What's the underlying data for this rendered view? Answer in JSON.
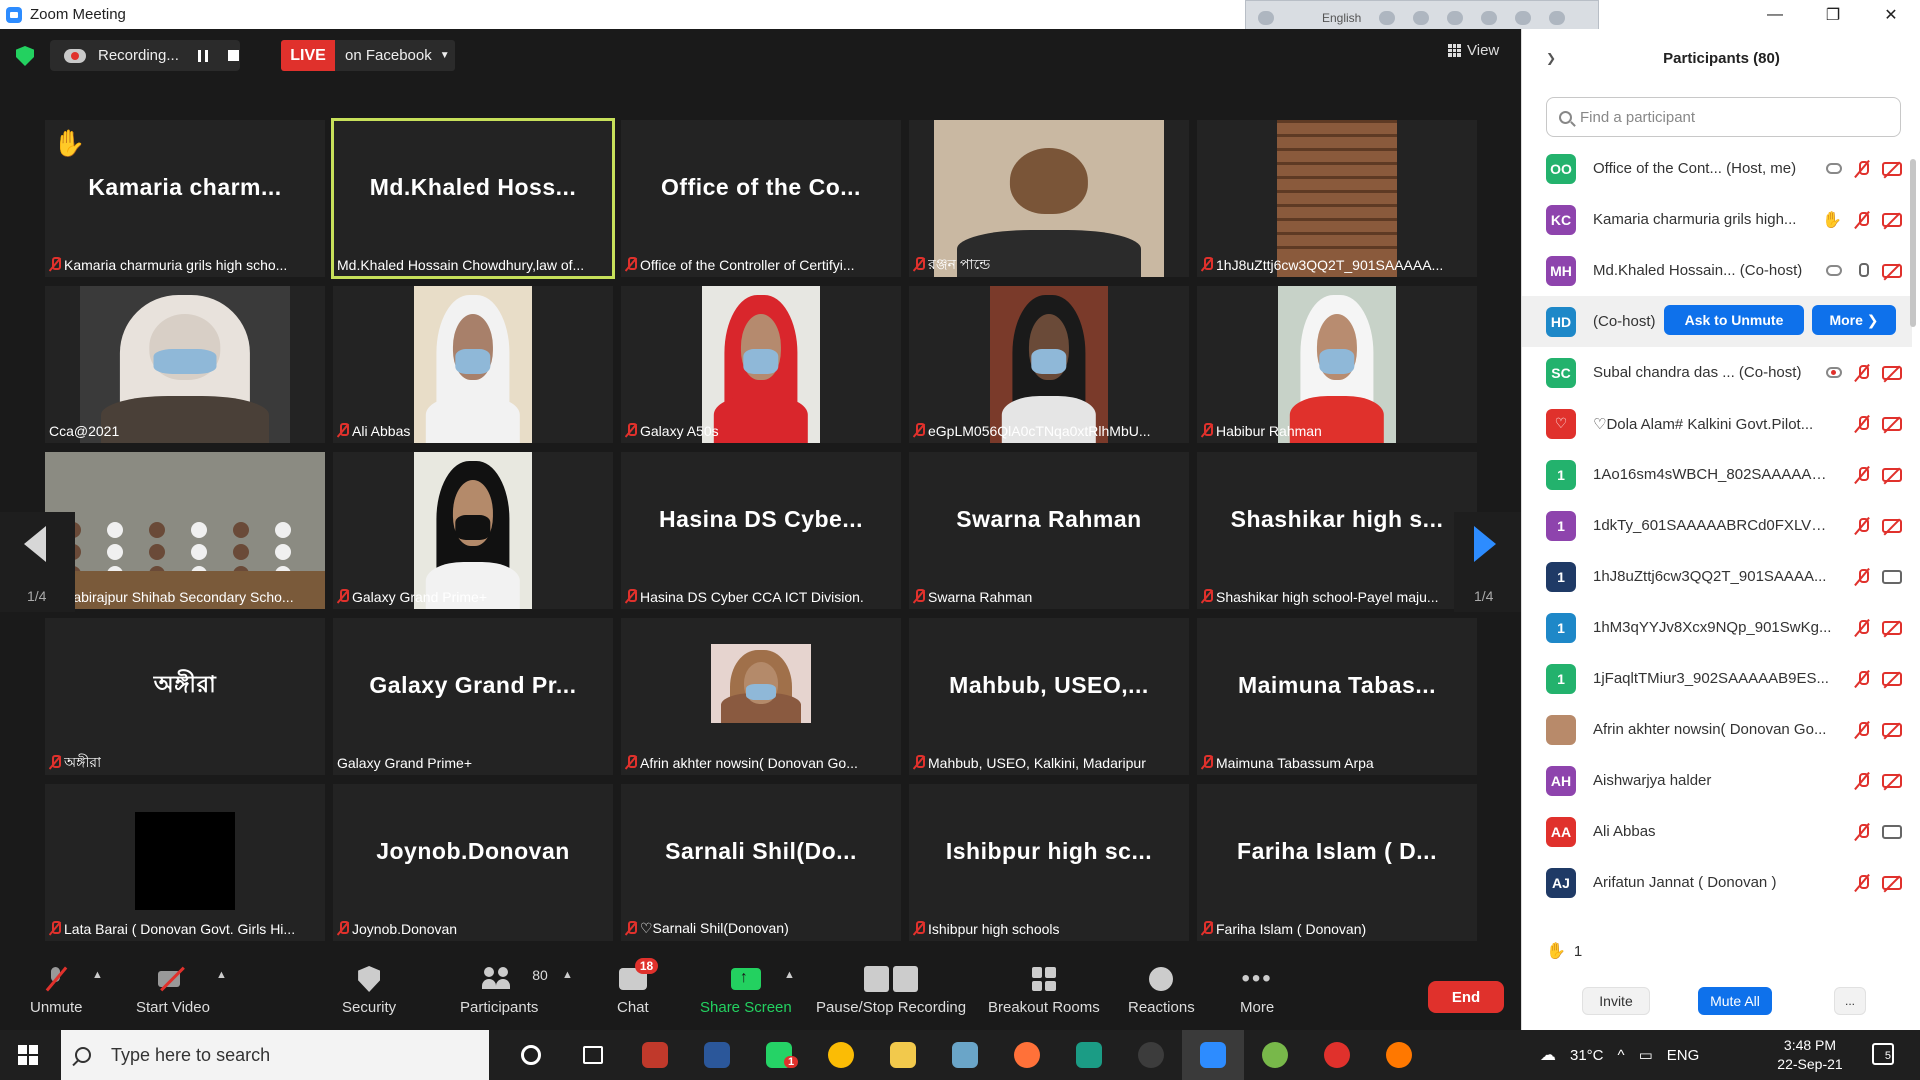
{
  "window": {
    "title": "Zoom Meeting",
    "language_bar_label": "English",
    "minimize": "—",
    "restore": "❐",
    "close": "✕"
  },
  "status": {
    "recording_text": "Recording...",
    "live_badge": "LIVE",
    "live_destination": "on Facebook",
    "view_label": "View"
  },
  "pager": {
    "left": "1/4",
    "right": "1/4"
  },
  "tiles": [
    {
      "big": "Kamaria  charm...",
      "label": "Kamaria charmuria grils high scho...",
      "hand": true
    },
    {
      "big": "Md.Khaled  Hoss...",
      "label": "Md.Khaled Hossain Chowdhury,law of...",
      "active": true,
      "nomic": true
    },
    {
      "big": "Office  of  the  Co...",
      "label": "Office of the Controller of Certifyi..."
    },
    {
      "photo": "man",
      "label": "রঞ্জন পান্ডে"
    },
    {
      "photo": "roof",
      "label": "1hJ8uZttj6cw3QQ2T_901SAAAAA..."
    },
    {
      "photo": "woman-dark",
      "label": "Cca@2021",
      "nomic": true
    },
    {
      "photo": "girl-white",
      "label": "Ali Abbas"
    },
    {
      "photo": "girl-red",
      "label": "Galaxy A50s"
    },
    {
      "photo": "girl-mask",
      "label": "eGpLM056QlA0cTNqa0xtRlhMbU..."
    },
    {
      "photo": "girl-hijab",
      "label": "Habibur Rahman"
    },
    {
      "photo": "classroom",
      "label": "Kabirajpur Shihab Secondary Scho..."
    },
    {
      "photo": "girl-black",
      "label": "Galaxy Grand Prime+"
    },
    {
      "big": "Hasina  DS  Cybe...",
      "label": "Hasina DS Cyber CCA ICT Division."
    },
    {
      "big": "Swarna  Rahman",
      "label": "Swarna Rahman"
    },
    {
      "big": "Shashikar  high  s...",
      "label": "Shashikar high school-Payel maju..."
    },
    {
      "big": "অঙ্গীরা",
      "label": "অঙ্গীরা"
    },
    {
      "big": "Galaxy  Grand  Pr...",
      "label": "Galaxy Grand Prime+",
      "nomic": true
    },
    {
      "photo": "girl-brown",
      "label": "Afrin akhter nowsin( Donovan Go..."
    },
    {
      "big": "Mahbub,  USEO,...",
      "label": "Mahbub, USEO, Kalkini, Madaripur"
    },
    {
      "big": "Maimuna  Tabas...",
      "label": "Maimuna Tabassum Arpa"
    },
    {
      "photo": "black",
      "label": "Lata Barai ( Donovan Govt. Girls Hi..."
    },
    {
      "big": "Joynob.Donovan",
      "label": "Joynob.Donovan"
    },
    {
      "big": "Sarnali  Shil(Do...",
      "label": "♡Sarnali Shil(Donovan)"
    },
    {
      "big": "Ishibpur  high  sc...",
      "label": "Ishibpur high schools"
    },
    {
      "big": "Fariha  Islam  (  D...",
      "label": "Fariha Islam ( Donovan)"
    }
  ],
  "toolbar": {
    "unmute": "Unmute",
    "start_video": "Start Video",
    "security": "Security",
    "participants": "Participants",
    "participants_count": "80",
    "chat": "Chat",
    "chat_badge": "18",
    "share_screen": "Share Screen",
    "pause_stop_recording": "Pause/Stop Recording",
    "breakout_rooms": "Breakout Rooms",
    "reactions": "Reactions",
    "more": "More",
    "end": "End"
  },
  "panel": {
    "title": "Participants (80)",
    "search_placeholder": "Find a participant",
    "ask_to_unmute": "Ask to Unmute",
    "more": "More ❯",
    "participants": [
      {
        "initials": "OO",
        "color": "#23b26d",
        "name": "Office of the Cont...  (Host, me)",
        "icons": [
          "cloud",
          "micoff",
          "camoff"
        ]
      },
      {
        "initials": "KC",
        "color": "#8e44ad",
        "name": "Kamaria charmuria grils high...",
        "icons": [
          "hand",
          "micoff",
          "camoff"
        ]
      },
      {
        "initials": "MH",
        "color": "#8e44ad",
        "name": "Md.Khaled Hossain...  (Co-host)",
        "icons": [
          "cloud",
          "micon",
          "camoff"
        ]
      },
      {
        "initials": "HD",
        "color": "#1e88c8",
        "name": "(Co-host)",
        "hover": true,
        "icons": []
      },
      {
        "initials": "SC",
        "color": "#23b26d",
        "name": "Subal chandra das ...  (Co-host)",
        "icons": [
          "rec",
          "micoff",
          "camoff"
        ]
      },
      {
        "initials": "♡",
        "color": "#e0312c",
        "name": "♡Dola Alam# Kalkini Govt.Pilot...",
        "icons": [
          "micoff",
          "camoff"
        ]
      },
      {
        "initials": "1",
        "color": "#23b26d",
        "name": "1Ao16sm4sWBCH_802SAAAAAB...",
        "icons": [
          "micoff",
          "camoff"
        ]
      },
      {
        "initials": "1",
        "color": "#8e44ad",
        "name": "1dkTy_601SAAAAABRCd0FXLVVt...",
        "icons": [
          "micoff",
          "camoff"
        ]
      },
      {
        "initials": "1",
        "color": "#1f3a66",
        "name": "1hJ8uZttj6cw3QQ2T_901SAAAA...",
        "icons": [
          "micoff",
          "camon"
        ]
      },
      {
        "initials": "1",
        "color": "#1e88c8",
        "name": "1hM3qYYJv8Xcx9NQp_901SwKg...",
        "icons": [
          "micoff",
          "camoff"
        ]
      },
      {
        "initials": "1",
        "color": "#23b26d",
        "name": "1jFaqltTMiur3_902SAAAAAB9ES...",
        "icons": [
          "micoff",
          "camoff"
        ]
      },
      {
        "initials": "",
        "color": "#b88a6a",
        "name": "Afrin akhter nowsin( Donovan Go...",
        "icons": [
          "micoff",
          "camoff"
        ]
      },
      {
        "initials": "AH",
        "color": "#8e44ad",
        "name": "Aishwarjya halder",
        "icons": [
          "micoff",
          "camoff"
        ]
      },
      {
        "initials": "AA",
        "color": "#e0312c",
        "name": "Ali Abbas",
        "icons": [
          "micoff",
          "camon"
        ]
      },
      {
        "initials": "AJ",
        "color": "#1f3a66",
        "name": "Arifatun Jannat ( Donovan )",
        "icons": [
          "micoff",
          "camoff"
        ]
      }
    ],
    "hand_count": "1",
    "invite": "Invite",
    "mute_all": "Mute All",
    "dots": "..."
  },
  "taskbar": {
    "search_placeholder": "Type here to search",
    "temperature": "31°C",
    "language": "ENG",
    "time": "3:48 PM",
    "date": "22-Sep-21",
    "notification_count": "5",
    "whatsapp_badge": "1",
    "apps": [
      "cortana",
      "task-view",
      "photos",
      "word",
      "whatsapp",
      "chrome",
      "explorer",
      "notes",
      "firefox",
      "app-blue",
      "obs",
      "zoom",
      "utorrent",
      "opera",
      "avast"
    ],
    "app_colors": [
      "#2b2b2b",
      "#2b2b2b",
      "#c0392b",
      "#2b579a",
      "#25d366",
      "#fbbc05",
      "#f2c94c",
      "#6aa5c8",
      "#ff7139",
      "#1b9c85",
      "#3c3c3c",
      "#2d8cff",
      "#78b84a",
      "#e0312c",
      "#ff7800"
    ]
  }
}
